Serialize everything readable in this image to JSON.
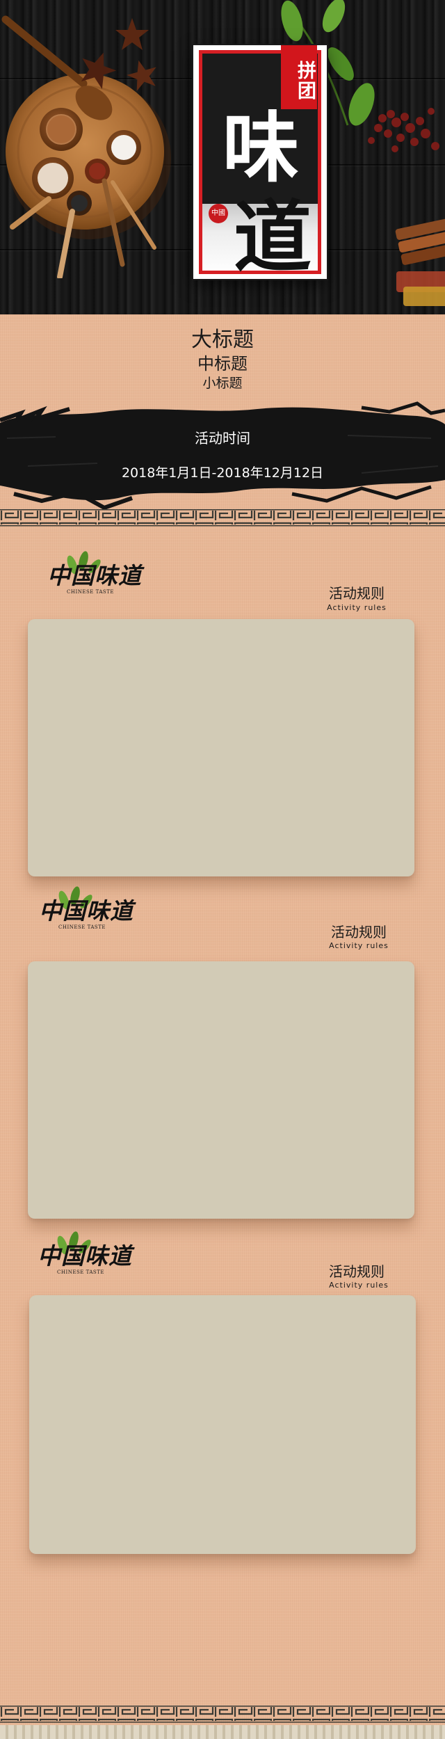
{
  "hero": {
    "badge_text": "拼团",
    "char_top": "味",
    "char_bottom": "道",
    "seal_text": "中國"
  },
  "header": {
    "big_title": "大标题",
    "mid_title": "中标题",
    "small_title": "小标题",
    "activity_time_label": "活动时间",
    "date_range": "2018年1月1日-2018年12月12日"
  },
  "sections": [
    {
      "logo_text": "中国味道",
      "logo_sub": "CHINESE TASTE",
      "rules_title": "活动规则",
      "rules_sub": "Activity rules"
    },
    {
      "logo_text": "中国味道",
      "logo_sub": "CHINESE TASTE",
      "rules_title": "活动规则",
      "rules_sub": "Activity rules"
    },
    {
      "logo_text": "中国味道",
      "logo_sub": "CHINESE TASTE",
      "rules_title": "活动规则",
      "rules_sub": "Activity rules"
    }
  ],
  "colors": {
    "brand_red": "#d61f24",
    "background_peach": "#e8b796",
    "card_beige": "#d2cbb6",
    "wood_dark": "#151515",
    "leaf_green": "#5f9e2f"
  },
  "icons": [
    "spice-bowl-icon",
    "wooden-spoon-icon",
    "star-anise-icon",
    "basil-leaf-icon",
    "peppercorn-icon",
    "cinnamon-stick-icon",
    "ink-brush-stroke",
    "fret-border"
  ]
}
